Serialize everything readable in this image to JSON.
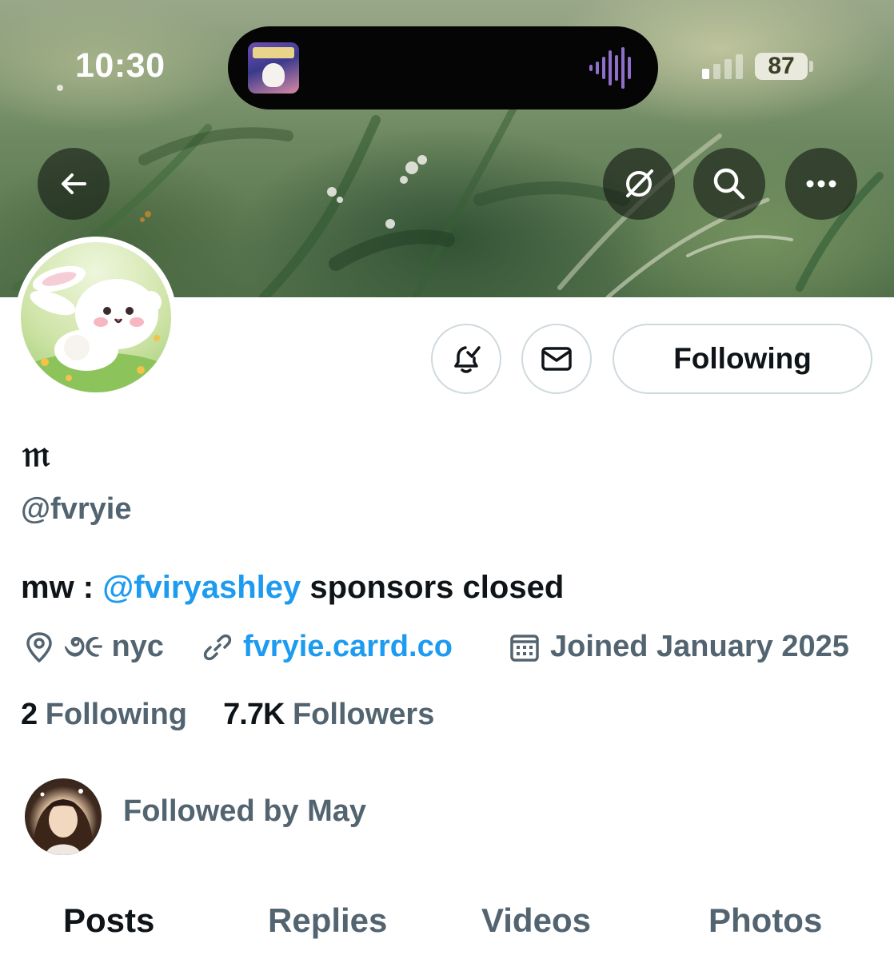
{
  "status_bar": {
    "time": "10:30",
    "battery": "87"
  },
  "header": {
    "back_icon": "arrow-left-icon",
    "actions": [
      "grok-icon",
      "search-icon",
      "more-icon"
    ]
  },
  "profile_actions": {
    "notify_icon": "bell-check-icon",
    "message_icon": "envelope-icon",
    "follow_label": "Following"
  },
  "profile": {
    "display_name": "𝔪",
    "handle": "@fvryie",
    "bio_prefix": "mw : ",
    "bio_mention": "@fviryashley",
    "bio_suffix": " sponsors closed",
    "location": "૭૯ nyc",
    "website": "fvryie.carrd.co",
    "joined": "Joined January 2025"
  },
  "stats": {
    "following_count": "2",
    "following_label": "Following",
    "followers_count": "7.7K",
    "followers_label": "Followers"
  },
  "followed_by": {
    "text": "Followed by May"
  },
  "tabs": [
    {
      "label": "Posts",
      "active": true
    },
    {
      "label": "Replies",
      "active": false
    },
    {
      "label": "Videos",
      "active": false
    },
    {
      "label": "Photos",
      "active": false
    }
  ],
  "colors": {
    "accent": "#1d9bf0",
    "secondary_text": "#536471",
    "primary_text": "#0f1419",
    "border": "#cfd9de"
  }
}
